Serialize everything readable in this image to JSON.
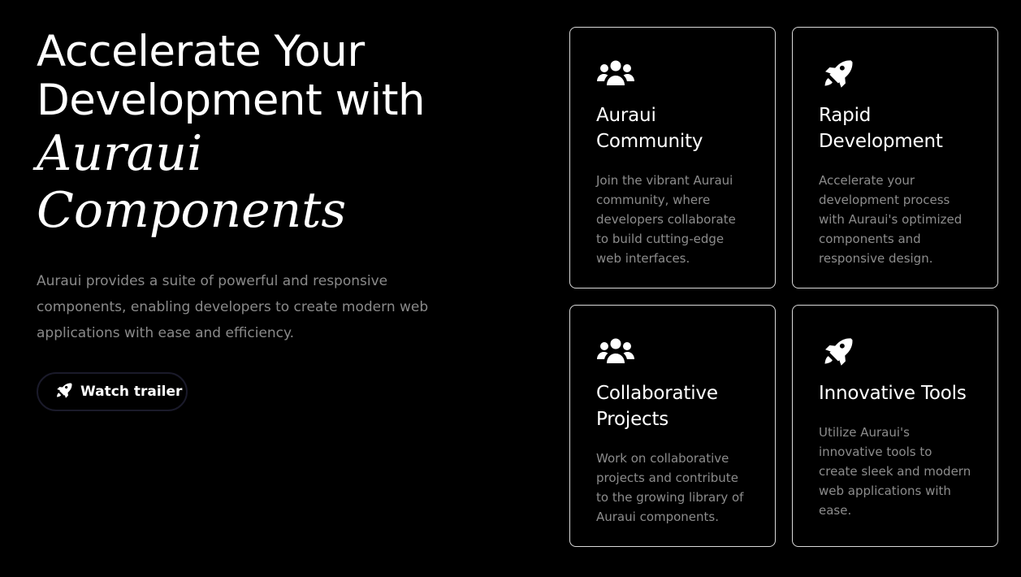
{
  "hero": {
    "headline_line1": "Accelerate Your",
    "headline_line2": "Development with",
    "headline_em1": "Auraui",
    "headline_em2": "Components",
    "description": "Auraui provides a suite of powerful and responsive components, enabling developers to create modern web applications with ease and efficiency.",
    "button_label": "Watch trailer",
    "button_icon": "rocket-icon"
  },
  "cards": [
    {
      "icon": "users-icon",
      "title": "Auraui Community",
      "text": "Join the vibrant Auraui community, where developers collaborate to build cutting-edge web interfaces."
    },
    {
      "icon": "rocket-icon",
      "title": "Rapid Development",
      "text": "Accelerate your development process with Auraui's optimized components and responsive design."
    },
    {
      "icon": "users-icon",
      "title": "Collaborative Projects",
      "text": "Work on collaborative projects and contribute to the growing library of Auraui components."
    },
    {
      "icon": "rocket-icon",
      "title": "Innovative Tools",
      "text": "Utilize Auraui's innovative tools to create sleek and modern web applications with ease."
    }
  ],
  "colors": {
    "background": "#000000",
    "text": "#ffffff",
    "muted_text": "#8a8a8a",
    "card_border": "#d9d9d9"
  }
}
